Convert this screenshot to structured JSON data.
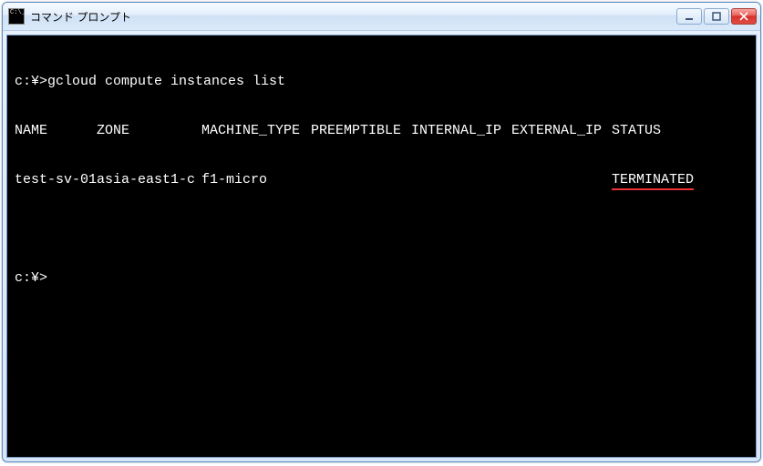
{
  "window": {
    "title": "コマンド プロンプト"
  },
  "terminal": {
    "prompt1": "c:¥>",
    "command": "gcloud compute instances list",
    "headers": {
      "name": "NAME",
      "zone": "ZONE",
      "machine_type": "MACHINE_TYPE",
      "preemptible": "PREEMPTIBLE",
      "internal_ip": "INTERNAL_IP",
      "external_ip": "EXTERNAL_IP",
      "status": "STATUS"
    },
    "rows": [
      {
        "name": "test-sv-01",
        "zone": "asia-east1-c",
        "machine_type": "f1-micro",
        "preemptible": "",
        "internal_ip": "          ",
        "external_ip": "",
        "status": "TERMINATED"
      }
    ],
    "prompt2": "c:¥>"
  }
}
